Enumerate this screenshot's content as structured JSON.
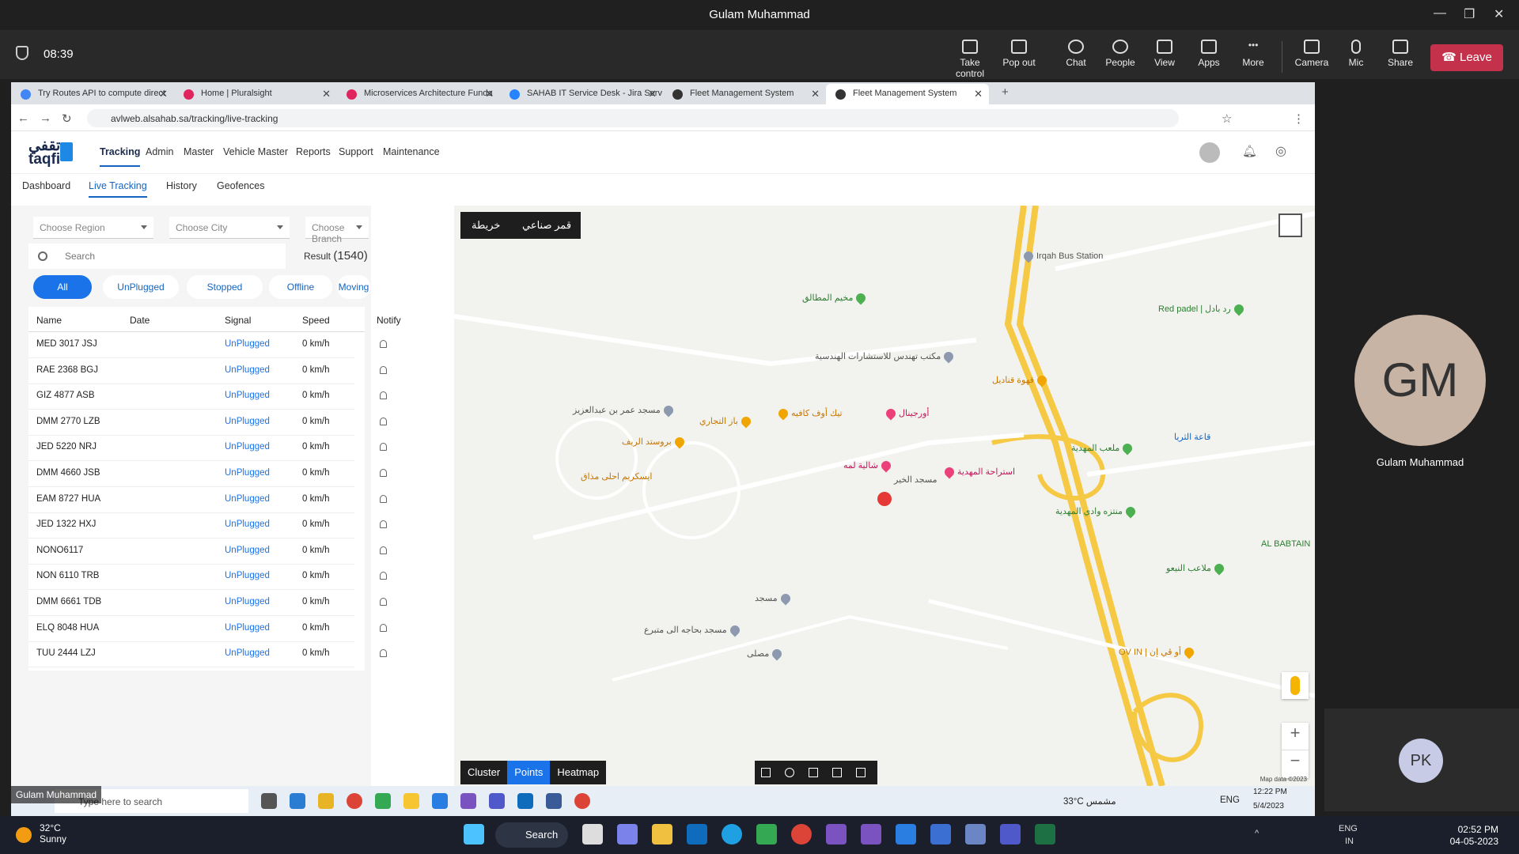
{
  "teams": {
    "window_title": "Gulam Muhammad",
    "timer": "08:39",
    "buttons": [
      "Take control",
      "Pop out",
      "Chat",
      "People",
      "View",
      "Apps",
      "More",
      "Camera",
      "Mic",
      "Share"
    ],
    "leave_label": "Leave",
    "participant_main_initials": "GM",
    "participant_main_name": "Gulam Muhammad",
    "participant_small_initials": "PK",
    "video_label": "Gulam Muhammad"
  },
  "browser": {
    "tabs": [
      {
        "title": "Try Routes API to compute direct",
        "color": "#4285f4"
      },
      {
        "title": "Home | Pluralsight",
        "color": "#e0245e"
      },
      {
        "title": "Microservices Architecture Funda",
        "color": "#e0245e"
      },
      {
        "title": "SAHAB IT Service Desk - Jira Serv",
        "color": "#2684ff"
      },
      {
        "title": "Fleet Management System",
        "color": "#333333"
      },
      {
        "title": "Fleet Management System",
        "color": "#333333"
      }
    ],
    "url": "avlweb.alsahab.sa/tracking/live-tracking"
  },
  "app": {
    "logo_ar": "تقفي",
    "logo_en": "taqfi",
    "menu": [
      "Tracking",
      "Admin",
      "Master",
      "Vehicle Master",
      "Reports",
      "Support",
      "Maintenance"
    ],
    "subnav": [
      "Dashboard",
      "Live Tracking",
      "History",
      "Geofences"
    ],
    "filters": {
      "region": "Choose Region",
      "city": "Choose City",
      "branch": "Choose Branch"
    },
    "search_placeholder": "Search",
    "result_label": "Result",
    "result_count": "(1540)",
    "status_pills": [
      "All",
      "UnPlugged",
      "Stopped",
      "Offline",
      "Moving"
    ],
    "table": {
      "headers": [
        "Name",
        "Date",
        "Signal",
        "Speed",
        "Notify"
      ],
      "rows": [
        {
          "name": "MED 3017 JSJ",
          "signal": "UnPlugged",
          "speed": "0 km/h"
        },
        {
          "name": "RAE 2368 BGJ",
          "signal": "UnPlugged",
          "speed": "0 km/h"
        },
        {
          "name": "GIZ 4877 ASB",
          "signal": "UnPlugged",
          "speed": "0 km/h"
        },
        {
          "name": "DMM 2770 LZB",
          "signal": "UnPlugged",
          "speed": "0 km/h"
        },
        {
          "name": "JED 5220 NRJ",
          "signal": "UnPlugged",
          "speed": "0 km/h"
        },
        {
          "name": "DMM 4660 JSB",
          "signal": "UnPlugged",
          "speed": "0 km/h"
        },
        {
          "name": "EAM 8727 HUA",
          "signal": "UnPlugged",
          "speed": "0 km/h"
        },
        {
          "name": "JED 1322 HXJ",
          "signal": "UnPlugged",
          "speed": "0 km/h"
        },
        {
          "name": "NONO6117",
          "signal": "UnPlugged",
          "speed": "0 km/h"
        },
        {
          "name": "NON 6110 TRB",
          "signal": "UnPlugged",
          "speed": "0 km/h"
        },
        {
          "name": "DMM 6661 TDB",
          "signal": "UnPlugged",
          "speed": "0 km/h"
        },
        {
          "name": "ELQ 8048 HUA",
          "signal": "UnPlugged",
          "speed": "0 km/h"
        },
        {
          "name": "TUU 2444 LZJ",
          "signal": "UnPlugged",
          "speed": "0 km/h"
        }
      ]
    },
    "map": {
      "type_map": "خريطة",
      "type_satellite": "قمر صناعي",
      "view_buttons": [
        "Cluster",
        "Points",
        "Heatmap"
      ],
      "attribution": "Map data ©2023",
      "places": [
        {
          "label": "Irqah Bus Station",
          "style": "grey"
        },
        {
          "label": "مخيم المطالق",
          "style": "green"
        },
        {
          "label": "Red padel | رد بادل",
          "style": "green"
        },
        {
          "label": "مسجد عمر بن عبدالعزيز",
          "style": "grey"
        },
        {
          "label": "باز التجاري",
          "style": "orange"
        },
        {
          "label": "تيك أوف كافيه",
          "style": "orange"
        },
        {
          "label": "بروستد الريف",
          "style": "orange"
        },
        {
          "label": "شالية لمه",
          "style": "pink"
        },
        {
          "label": "مسجد الخير",
          "style": "grey"
        },
        {
          "label": "استراحة المهدية",
          "style": "pink"
        },
        {
          "label": "ايسكريم احلى مذاق",
          "style": "orange"
        },
        {
          "label": "منتزه وادي المهدية",
          "style": "green"
        },
        {
          "label": "AL BABTAIN",
          "style": "green"
        },
        {
          "label": "ملاعب النيعو",
          "style": "green"
        },
        {
          "label": "OV IN | أو ڤي إن",
          "style": "orange"
        },
        {
          "label": "مسجد بحاجه الى متبرع",
          "style": "grey"
        },
        {
          "label": "مصلى",
          "style": "grey"
        },
        {
          "label": "مسجد",
          "style": "grey"
        },
        {
          "label": "قهوة قناديل",
          "style": "orange"
        },
        {
          "label": "ملعب المهدية",
          "style": "green"
        },
        {
          "label": "قاعة الثريا",
          "style": "blue"
        },
        {
          "label": "مكتب تهندس للاستشارات الهندسية",
          "style": "grey"
        },
        {
          "label": "أورجينال",
          "style": "pink"
        }
      ]
    }
  },
  "inner_taskbar": {
    "search_placeholder": "Type here to search",
    "weather": "33°C مشمس",
    "lang": "ENG",
    "time": "12:22 PM",
    "date": "5/4/2023"
  },
  "taskbar": {
    "temp": "32°C",
    "condition": "Sunny",
    "search_label": "Search",
    "lang": "ENG",
    "region": "IN",
    "time": "02:52 PM",
    "date": "04-05-2023"
  }
}
